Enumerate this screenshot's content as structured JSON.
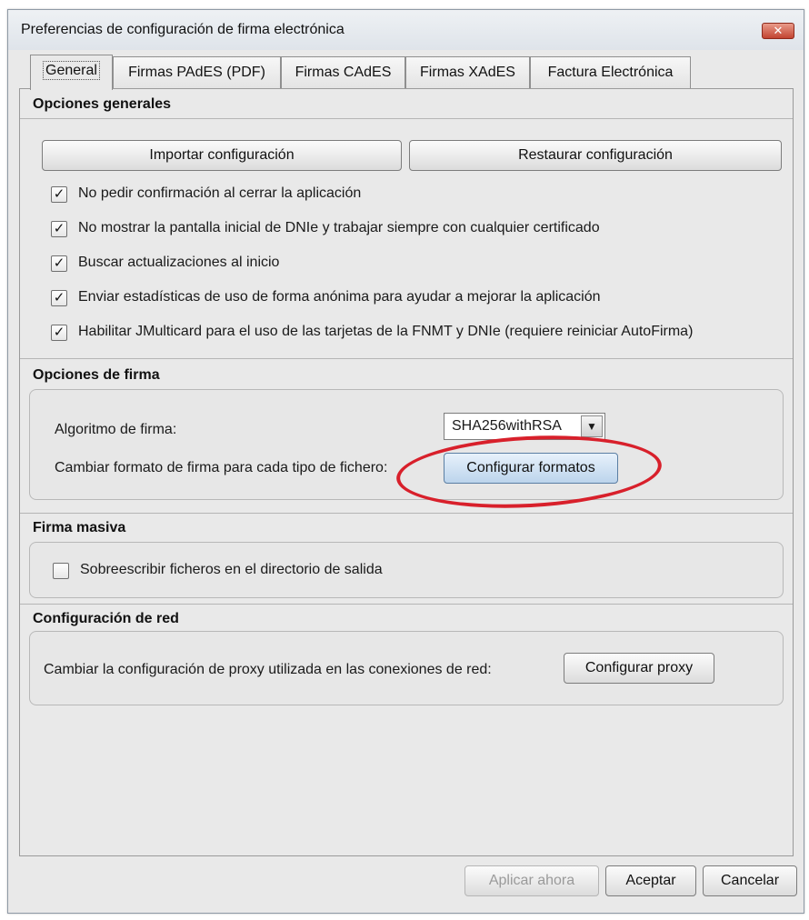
{
  "window": {
    "title": "Preferencias de configuración de firma electrónica",
    "close_symbol": "✕"
  },
  "tabs": [
    {
      "label": "General",
      "active": true
    },
    {
      "label": "Firmas PAdES (PDF)",
      "active": false
    },
    {
      "label": "Firmas CAdES",
      "active": false
    },
    {
      "label": "Firmas XAdES",
      "active": false
    },
    {
      "label": "Factura Electrónica",
      "active": false
    }
  ],
  "general": {
    "title": "Opciones generales",
    "import_button": "Importar configuración",
    "restore_button": "Restaurar configuración",
    "options": [
      {
        "label": "No pedir confirmación al cerrar la aplicación",
        "checked": true
      },
      {
        "label": "No mostrar la pantalla inicial de DNIe y trabajar siempre con cualquier certificado",
        "checked": true
      },
      {
        "label": "Buscar actualizaciones al inicio",
        "checked": true
      },
      {
        "label": "Enviar estadísticas de uso de forma anónima para ayudar a mejorar la aplicación",
        "checked": true
      },
      {
        "label": "Habilitar JMulticard para el uso de las tarjetas de la FNMT y DNIe (requiere reiniciar AutoFirma)",
        "checked": true
      }
    ]
  },
  "signature": {
    "title": "Opciones de firma",
    "algorithm_label": "Algoritmo de firma:",
    "algorithm_value": "SHA256withRSA",
    "format_label": "Cambiar formato de firma para cada tipo de fichero:",
    "format_button": "Configurar formatos",
    "annotation_color": "#d8202b"
  },
  "bulk": {
    "title": "Firma masiva",
    "overwrite_label": "Sobreescribir ficheros en el directorio de salida",
    "overwrite_checked": false
  },
  "network": {
    "title": "Configuración de red",
    "proxy_label": "Cambiar la configuración de proxy utilizada en las conexiones de red:",
    "proxy_button": "Configurar proxy"
  },
  "footer": {
    "apply_button": "Aplicar ahora",
    "accept_button": "Aceptar",
    "cancel_button": "Cancelar"
  }
}
